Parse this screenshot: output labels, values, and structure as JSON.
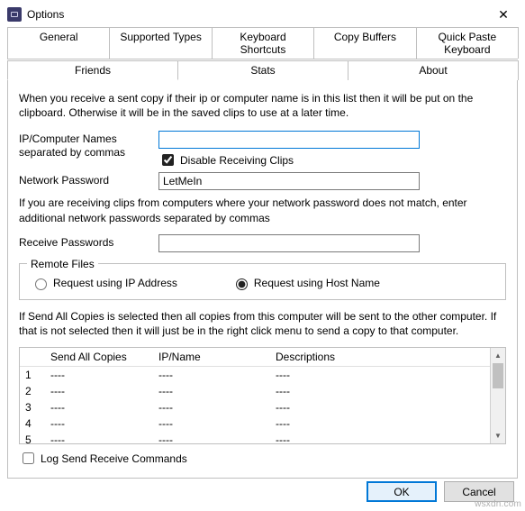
{
  "window": {
    "title": "Options",
    "close": "✕"
  },
  "tabs1": [
    "General",
    "Supported Types",
    "Keyboard Shortcuts",
    "Copy Buffers",
    "Quick Paste Keyboard"
  ],
  "tabs2": [
    "Friends",
    "Stats",
    "About"
  ],
  "active_tab": "Friends",
  "intro": "When you receive a sent copy if their ip or computer name is in this list then it will be put on the clipboard.  Otherwise it will be in the saved clips to use at a later time.",
  "ipnames": {
    "label": "IP/Computer Names separated by commas",
    "value": "",
    "disable_label": "Disable Receiving Clips",
    "disable_checked": true
  },
  "netpass": {
    "label": "Network Password",
    "value": "LetMeIn"
  },
  "pwnote": "If you are receiving clips from computers where your network password does not match, enter additional network passwords separated by commas",
  "recvpw": {
    "label": "Receive Passwords",
    "value": ""
  },
  "remote": {
    "legend": "Remote Files",
    "opt_ip": "Request using IP Address",
    "opt_host": "Request using Host Name",
    "selected": "host"
  },
  "sendnote": "If Send All Copies is selected then all copies from this computer will be sent to the other computer.  If that is not selected then it will just be in the right click menu to send a copy to that computer.",
  "table": {
    "headers": [
      "",
      "Send All Copies",
      "IP/Name",
      "Descriptions"
    ],
    "rows": [
      {
        "n": "1",
        "a": "----",
        "b": "----",
        "c": "----"
      },
      {
        "n": "2",
        "a": "----",
        "b": "----",
        "c": "----"
      },
      {
        "n": "3",
        "a": "----",
        "b": "----",
        "c": "----"
      },
      {
        "n": "4",
        "a": "----",
        "b": "----",
        "c": "----"
      },
      {
        "n": "5",
        "a": "----",
        "b": "----",
        "c": "----"
      }
    ]
  },
  "log": {
    "label": "Log Send Receive Commands",
    "checked": false
  },
  "buttons": {
    "ok": "OK",
    "cancel": "Cancel"
  },
  "watermark": "wsxdn.com"
}
